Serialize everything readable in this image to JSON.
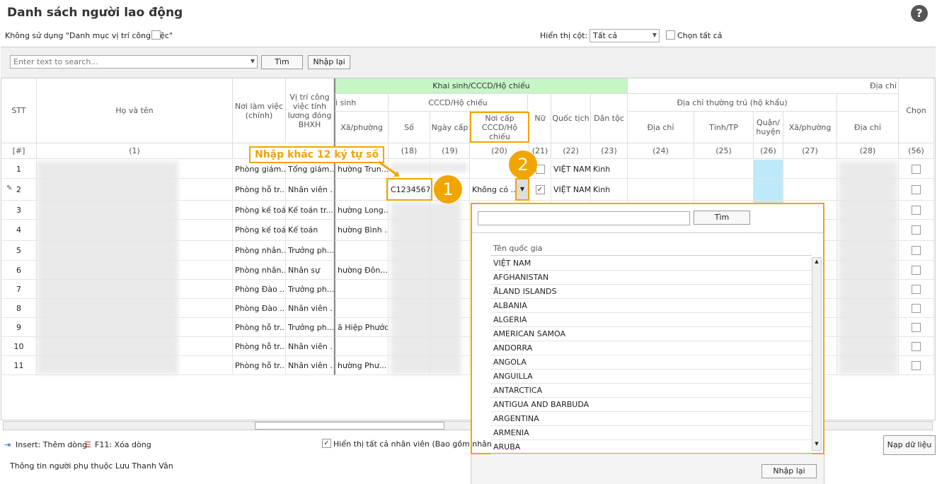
{
  "title": "Danh sách người lao động",
  "help_icon": "?",
  "options": {
    "no_use_label": "Không sử dụng \"Danh mục vị trí công việc\"",
    "show_cols_label": "Hiển thị cột:",
    "show_cols_value": "Tất cả",
    "select_all_label": "Chọn tất cả"
  },
  "search": {
    "placeholder": "Enter text to search...",
    "find": "Tìm",
    "reset": "Nhập lại"
  },
  "headers": {
    "stt": "STT",
    "name": "Họ và tên",
    "workplace": "Nơi làm việc (chính)",
    "position": "Vị trí công việc tính lương đóng BHXH",
    "group_khaisinh": "Khai sinh/CCCD/Hộ chiếu",
    "khaisinh_sub": "i sinh",
    "ward": "Xã/phường",
    "cccd_group": "CCCD/Hộ chiếu",
    "number": "Số",
    "issue_date": "Ngày cấp",
    "issue_place": "Nơi cấp CCCD/Hộ chiếu",
    "female": "Nữ",
    "nationality": "Quốc tịch",
    "ethnic": "Dân tộc",
    "group_address": "Địa chỉ",
    "perm_address": "Địa chỉ thường trú (hộ khẩu)",
    "address": "Địa chỉ",
    "province": "Tỉnh/TP",
    "district": "Quận/ huyện",
    "ward2": "Xã/phường",
    "address2": "Địa chỉ",
    "choose": "Chọn"
  },
  "col_numbers": [
    "[#]",
    "(1)",
    "(18)",
    "(19)",
    "(20)",
    "(21)",
    "(22)",
    "(23)",
    "(24)",
    "(25)",
    "(26)",
    "(27)",
    "(28)",
    "(56)"
  ],
  "rows": [
    {
      "stt": "1",
      "workplace": "Phòng giám...",
      "position": "Tổng giám...",
      "ward": "hường Trun...",
      "issue_place": "",
      "female": false,
      "nationality": "VIỆT NAM",
      "ethnic": "Kinh",
      "number": ""
    },
    {
      "stt": "2",
      "workplace": "Phòng hỗ tr...",
      "position": "Nhân viên ...",
      "ward": "",
      "issue_place": "Không có ...",
      "female": true,
      "nationality": "VIỆT NAM",
      "ethnic": "Kinh",
      "number": "C1234567"
    },
    {
      "stt": "3",
      "workplace": "Phòng kế toán",
      "position": "Kế toán tr...",
      "ward": "hường Long...",
      "issue_place": "",
      "female": false,
      "nationality": "",
      "ethnic": "",
      "number": ""
    },
    {
      "stt": "4",
      "workplace": "Phòng kế toán",
      "position": "Kế toán",
      "ward": "hường Bình ...",
      "issue_place": "",
      "female": false,
      "nationality": "",
      "ethnic": "",
      "number": ""
    },
    {
      "stt": "5",
      "workplace": "Phòng nhân...",
      "position": "Trưởng ph...",
      "ward": "",
      "issue_place": "",
      "female": false,
      "nationality": "",
      "ethnic": "",
      "number": ""
    },
    {
      "stt": "6",
      "workplace": "Phòng nhân...",
      "position": "Nhân sự",
      "ward": "hường Đôn...",
      "issue_place": "",
      "female": false,
      "nationality": "",
      "ethnic": "",
      "number": ""
    },
    {
      "stt": "7",
      "workplace": "Phòng Đào ...",
      "position": "Trưởng ph...",
      "ward": "",
      "issue_place": "",
      "female": false,
      "nationality": "",
      "ethnic": "",
      "number": ""
    },
    {
      "stt": "8",
      "workplace": "Phòng Đào ...",
      "position": "Nhân viên ...",
      "ward": "",
      "issue_place": "",
      "female": false,
      "nationality": "",
      "ethnic": "",
      "number": ""
    },
    {
      "stt": "9",
      "workplace": "Phòng hỗ tr...",
      "position": "Trưởng ph...",
      "ward": "ã Hiệp Phước",
      "issue_place": "",
      "female": false,
      "nationality": "",
      "ethnic": "",
      "number": ""
    },
    {
      "stt": "10",
      "workplace": "Phòng hỗ tr...",
      "position": "Nhân viên ...",
      "ward": "",
      "issue_place": "",
      "female": false,
      "nationality": "",
      "ethnic": "",
      "number": ""
    },
    {
      "stt": "11",
      "workplace": "Phòng hỗ tr...",
      "position": "Nhân viên ...",
      "ward": "hường Phư...",
      "issue_place": "",
      "female": false,
      "nationality": "",
      "ethnic": "",
      "number": ""
    }
  ],
  "callout": "Nhập khác 12 ký tự số",
  "badge1": "1",
  "badge2": "2",
  "dropdown": {
    "find": "Tìm",
    "col_header": "Tên quốc gia",
    "items": [
      "VIỆT NAM",
      "AFGHANISTAN",
      "ÅLAND ISLANDS",
      "ALBANIA",
      "ALGERIA",
      "AMERICAN SAMOA",
      "ANDORRA",
      "ANGOLA",
      "ANGUILLA",
      "ANTARCTICA",
      "ANTIGUA AND BARBUDA",
      "ARGENTINA",
      "ARMENIA",
      "ARUBA"
    ],
    "reset": "Nhập lại"
  },
  "footer": {
    "insert": "Insert: Thêm dòng",
    "delete": "F11: Xóa dòng",
    "show_all": "Hiển thị tất cả nhân viên (Bao gồm nhân",
    "load": "Nạp dữ liệu",
    "dependent": "Thông tin người phụ thuộc Lưu Thanh Vân"
  }
}
